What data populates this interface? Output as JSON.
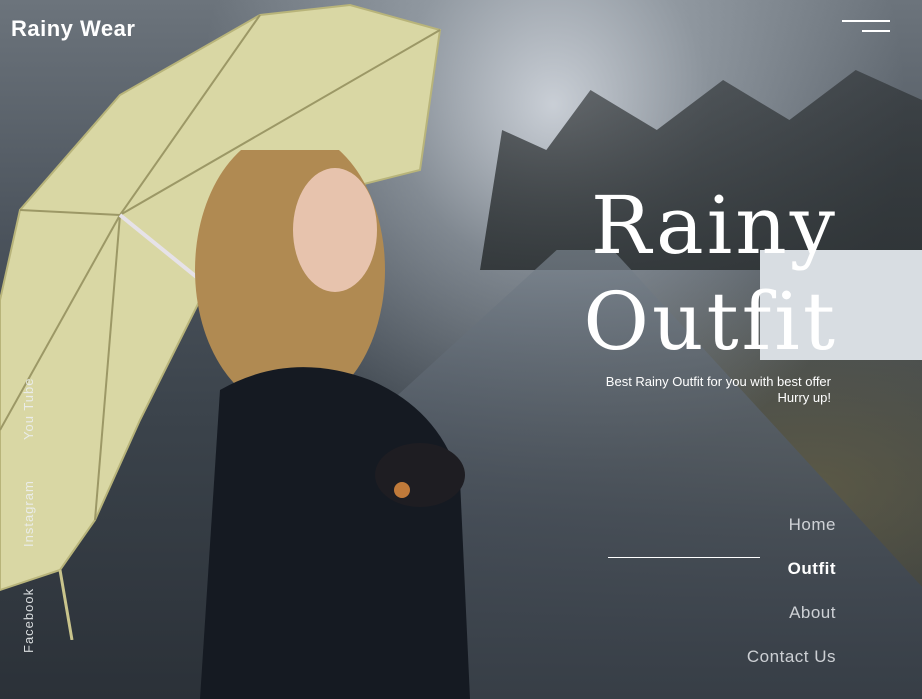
{
  "brand": {
    "name": "Rainy Wear"
  },
  "menu": {
    "icon": "hamburger-menu-icon"
  },
  "hero": {
    "headline_line1": "Rainy",
    "headline_line2": "Outfit",
    "tagline_line1": "Best Rainy Outfit for you with best offer",
    "tagline_line2": "Hurry up!"
  },
  "nav": {
    "items": [
      {
        "label": "Home",
        "active": false
      },
      {
        "label": "Outfit",
        "active": true
      },
      {
        "label": "About",
        "active": false
      },
      {
        "label": "Contact Us",
        "active": false
      }
    ]
  },
  "social": {
    "items": [
      {
        "label": "You Tube"
      },
      {
        "label": "Instagram"
      },
      {
        "label": "Facebook"
      }
    ]
  }
}
